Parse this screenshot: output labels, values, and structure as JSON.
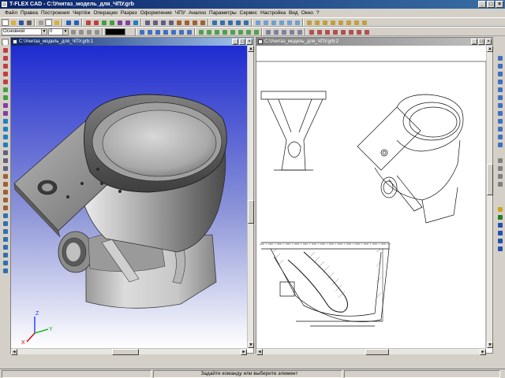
{
  "window": {
    "title": "T-FLEX CAD - C:\\Унитаз_модель_для_ЧПУ.grb"
  },
  "menu": [
    "Файл",
    "Правка",
    "Построения",
    "Чертёж",
    "Операции",
    "Разрез",
    "Оформление",
    "ЧПУ",
    "Анализ",
    "Параметры",
    "Сервис",
    "Настройка",
    "Вид",
    "Окно",
    "?"
  ],
  "toolbar": {
    "layer_value": "Основной",
    "line_value": "0"
  },
  "doc3d": {
    "title": "C:\\Унитаз_модель_для_ЧПУ.grb:1"
  },
  "doc2d": {
    "title": "C:\\Унитаз_модель_для_ЧПУ.grb:2"
  },
  "axes": {
    "x": "X",
    "y": "Y",
    "z": "Z"
  },
  "status": {
    "message": "Задайте команду или выберите элемент"
  },
  "colors": {
    "viewport_top": "#1e2bd0",
    "viewport_bottom": "#ffffff",
    "titlebar": "#0a246a"
  },
  "icons": [
    "new-file-icon",
    "open-icon",
    "save-icon",
    "print-icon",
    "undo-icon",
    "redo-icon",
    "zoom-in-icon",
    "zoom-out-icon",
    "rotate-icon",
    "pan-icon"
  ]
}
